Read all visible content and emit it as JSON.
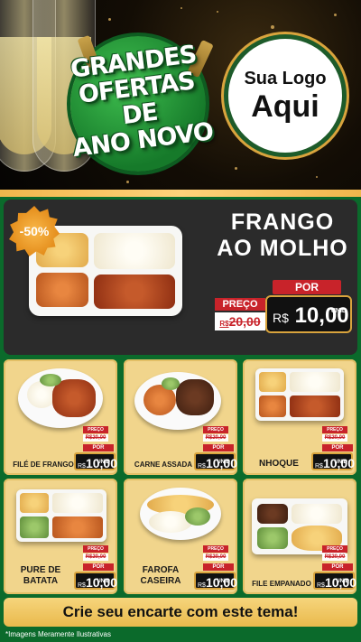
{
  "header": {
    "headline_lines": [
      "GRANDES",
      "OFERTAS DE",
      "ANO NOVO"
    ],
    "logo_line1": "Sua Logo",
    "logo_line2": "Aqui"
  },
  "feature": {
    "discount": "-50%",
    "title_line1": "FRANGO",
    "title_line2": "AO MOLHO",
    "preco_label": "PREÇO",
    "old_currency": "R$",
    "old_price": "20,00",
    "por_label": "POR",
    "currency": "R$",
    "price": "10,00",
    "unit": "UNID"
  },
  "products": [
    {
      "name": "FILÉ DE FRANGO",
      "preco_label": "PREÇO",
      "old_price": "R$20,00",
      "por_label": "POR",
      "currency": "R$",
      "price": "10,00",
      "unit": "UNID"
    },
    {
      "name": "CARNE ASSADA",
      "preco_label": "PREÇO",
      "old_price": "R$20,00",
      "por_label": "POR",
      "currency": "R$",
      "price": "10,00",
      "unit": "UNID"
    },
    {
      "name": "NHOQUE",
      "preco_label": "PREÇO",
      "old_price": "R$20,00",
      "por_label": "POR",
      "currency": "R$",
      "price": "10,00",
      "unit": "UNID"
    },
    {
      "name_line1": "PURE DE",
      "name_line2": "BATATA",
      "preco_label": "PREÇO",
      "old_price": "R$20,00",
      "por_label": "POR",
      "currency": "R$",
      "price": "10,00",
      "unit": "UNID"
    },
    {
      "name_line1": "FAROFA",
      "name_line2": "CASEIRA",
      "preco_label": "PREÇO",
      "old_price": "R$20,00",
      "por_label": "POR",
      "currency": "R$",
      "price": "10,00",
      "unit": "UNID"
    },
    {
      "name": "FILE EMPANADO",
      "preco_label": "PREÇO",
      "old_price": "R$20,00",
      "por_label": "POR",
      "currency": "R$",
      "price": "10,00",
      "unit": "UNID"
    }
  ],
  "footer": {
    "cta": "Crie seu encarte com este tema!",
    "note": "*Imagens Meramente Ilustrativas"
  },
  "colors": {
    "background_green": "#0b6a2b",
    "gold": "#f1d58c",
    "price_red": "#c8232a",
    "feature_card": "#2b2b2b"
  }
}
